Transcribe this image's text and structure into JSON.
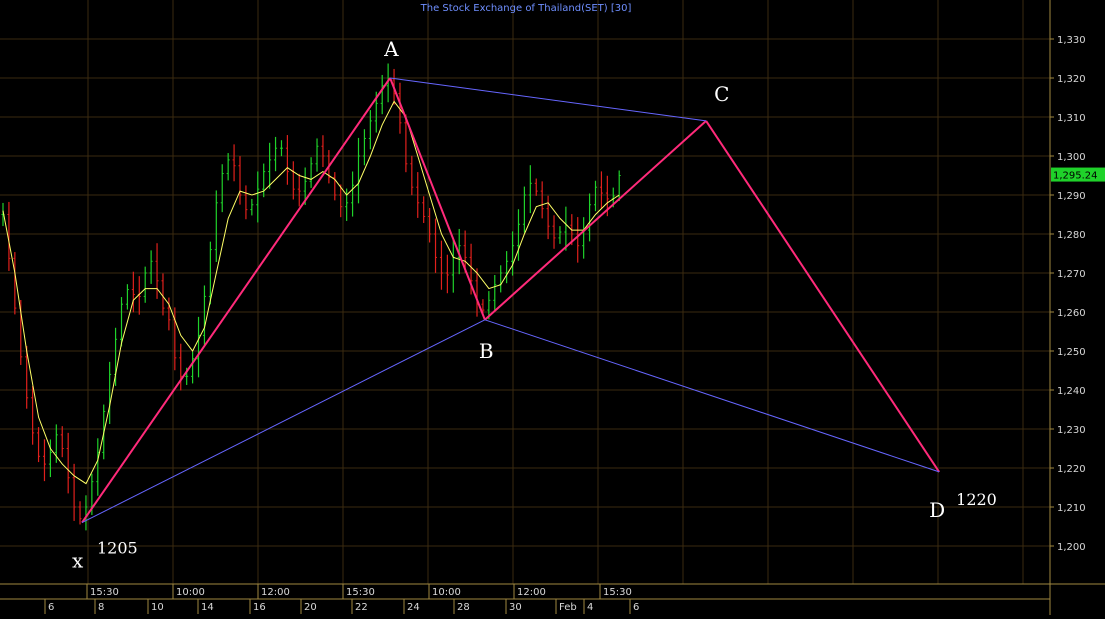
{
  "title": "The Stock Exchange of Thailand(SET) [30]",
  "colors": {
    "background": "#000000",
    "grid": "#3a2a10",
    "frame": "#a08840",
    "axis_text": "#d8d8d8",
    "title": "#6f8fff",
    "bull": "#1fd22a",
    "bear": "#e0201c",
    "moving_average": "#ffff66",
    "pattern_leg": "#ff2a7a",
    "pattern_connector": "#6666ff",
    "label": "#ffffff",
    "price_tag_bg": "#1fd22a",
    "price_tag_text": "#000000"
  },
  "chart_data": {
    "type": "line",
    "title": "The Stock Exchange of Thailand(SET) [30]",
    "y_axis": {
      "side": "right",
      "min": 1190,
      "max": 1340,
      "ticks": [
        "1,200",
        "1,210",
        "1,220",
        "1,230",
        "1,240",
        "1,250",
        "1,260",
        "1,270",
        "1,280",
        "1,290",
        "1,300",
        "1,310",
        "1,320",
        "1,330"
      ]
    },
    "last_price": "1,295.24",
    "time_labels": [
      "15:30",
      "10:00",
      "12:00",
      "15:30",
      "10:00",
      "12:00",
      "15:30"
    ],
    "date_labels": [
      "6",
      "8",
      "10",
      "14",
      "16",
      "20",
      "22",
      "24",
      "28",
      "30",
      "Feb",
      "4",
      "6"
    ],
    "price_path": [
      [
        0,
        1285
      ],
      [
        2,
        1270
      ],
      [
        4,
        1252
      ],
      [
        6,
        1238
      ],
      [
        8,
        1226
      ],
      [
        10,
        1220
      ],
      [
        12,
        1224
      ],
      [
        14,
        1230
      ],
      [
        16,
        1220
      ],
      [
        18,
        1210
      ],
      [
        20,
        1206
      ],
      [
        22,
        1214
      ],
      [
        24,
        1224
      ],
      [
        26,
        1238
      ],
      [
        28,
        1250
      ],
      [
        30,
        1262
      ],
      [
        32,
        1267
      ],
      [
        34,
        1262
      ],
      [
        36,
        1270
      ],
      [
        38,
        1274
      ],
      [
        40,
        1262
      ],
      [
        42,
        1258
      ],
      [
        44,
        1245
      ],
      [
        46,
        1242
      ],
      [
        48,
        1248
      ],
      [
        50,
        1256
      ],
      [
        52,
        1272
      ],
      [
        54,
        1288
      ],
      [
        56,
        1298
      ],
      [
        58,
        1300
      ],
      [
        60,
        1290
      ],
      [
        62,
        1285
      ],
      [
        64,
        1290
      ],
      [
        66,
        1296
      ],
      [
        68,
        1300
      ],
      [
        70,
        1304
      ],
      [
        72,
        1296
      ],
      [
        74,
        1290
      ],
      [
        76,
        1292
      ],
      [
        78,
        1298
      ],
      [
        80,
        1304
      ],
      [
        82,
        1296
      ],
      [
        84,
        1290
      ],
      [
        86,
        1286
      ],
      [
        88,
        1290
      ],
      [
        90,
        1300
      ],
      [
        92,
        1306
      ],
      [
        94,
        1312
      ],
      [
        96,
        1318
      ],
      [
        98,
        1320
      ],
      [
        100,
        1312
      ],
      [
        102,
        1298
      ],
      [
        104,
        1290
      ],
      [
        106,
        1286
      ],
      [
        108,
        1280
      ],
      [
        110,
        1272
      ],
      [
        112,
        1268
      ],
      [
        114,
        1274
      ],
      [
        116,
        1278
      ],
      [
        118,
        1270
      ],
      [
        120,
        1262
      ],
      [
        122,
        1260
      ],
      [
        124,
        1266
      ],
      [
        126,
        1270
      ],
      [
        128,
        1274
      ],
      [
        130,
        1280
      ],
      [
        132,
        1290
      ],
      [
        134,
        1294
      ],
      [
        136,
        1288
      ],
      [
        138,
        1282
      ],
      [
        140,
        1278
      ],
      [
        142,
        1283
      ],
      [
        144,
        1280
      ],
      [
        146,
        1276
      ],
      [
        148,
        1286
      ],
      [
        150,
        1292
      ],
      [
        152,
        1290
      ],
      [
        154,
        1288
      ],
      [
        156,
        1295
      ]
    ],
    "moving_average": [
      [
        0,
        1286
      ],
      [
        3,
        1270
      ],
      [
        6,
        1250
      ],
      [
        9,
        1233
      ],
      [
        12,
        1225
      ],
      [
        15,
        1221
      ],
      [
        18,
        1218
      ],
      [
        21,
        1216
      ],
      [
        24,
        1222
      ],
      [
        27,
        1236
      ],
      [
        30,
        1252
      ],
      [
        33,
        1263
      ],
      [
        36,
        1266
      ],
      [
        39,
        1266
      ],
      [
        42,
        1262
      ],
      [
        45,
        1254
      ],
      [
        48,
        1250
      ],
      [
        51,
        1256
      ],
      [
        54,
        1270
      ],
      [
        57,
        1284
      ],
      [
        60,
        1291
      ],
      [
        63,
        1290
      ],
      [
        66,
        1291
      ],
      [
        69,
        1294
      ],
      [
        72,
        1297
      ],
      [
        75,
        1295
      ],
      [
        78,
        1294
      ],
      [
        81,
        1296
      ],
      [
        84,
        1294
      ],
      [
        87,
        1290
      ],
      [
        90,
        1293
      ],
      [
        93,
        1300
      ],
      [
        96,
        1308
      ],
      [
        99,
        1314
      ],
      [
        102,
        1310
      ],
      [
        105,
        1300
      ],
      [
        108,
        1290
      ],
      [
        111,
        1280
      ],
      [
        114,
        1274
      ],
      [
        117,
        1273
      ],
      [
        120,
        1270
      ],
      [
        123,
        1266
      ],
      [
        126,
        1267
      ],
      [
        129,
        1272
      ],
      [
        132,
        1280
      ],
      [
        135,
        1287
      ],
      [
        138,
        1288
      ],
      [
        141,
        1284
      ],
      [
        144,
        1281
      ],
      [
        147,
        1281
      ],
      [
        150,
        1285
      ],
      [
        153,
        1288
      ],
      [
        156,
        1290
      ]
    ],
    "pattern": {
      "points": [
        {
          "label": "x",
          "bar": 20,
          "value": 1206
        },
        {
          "label": "A",
          "bar": 98,
          "value": 1320
        },
        {
          "label": "B",
          "bar": 122,
          "value": 1258
        },
        {
          "label": "C",
          "bar": 178,
          "value": 1309
        },
        {
          "label": "D",
          "bar": 237,
          "value": 1219
        }
      ],
      "value_labels": {
        "x": "1205",
        "D": "1220"
      }
    }
  }
}
